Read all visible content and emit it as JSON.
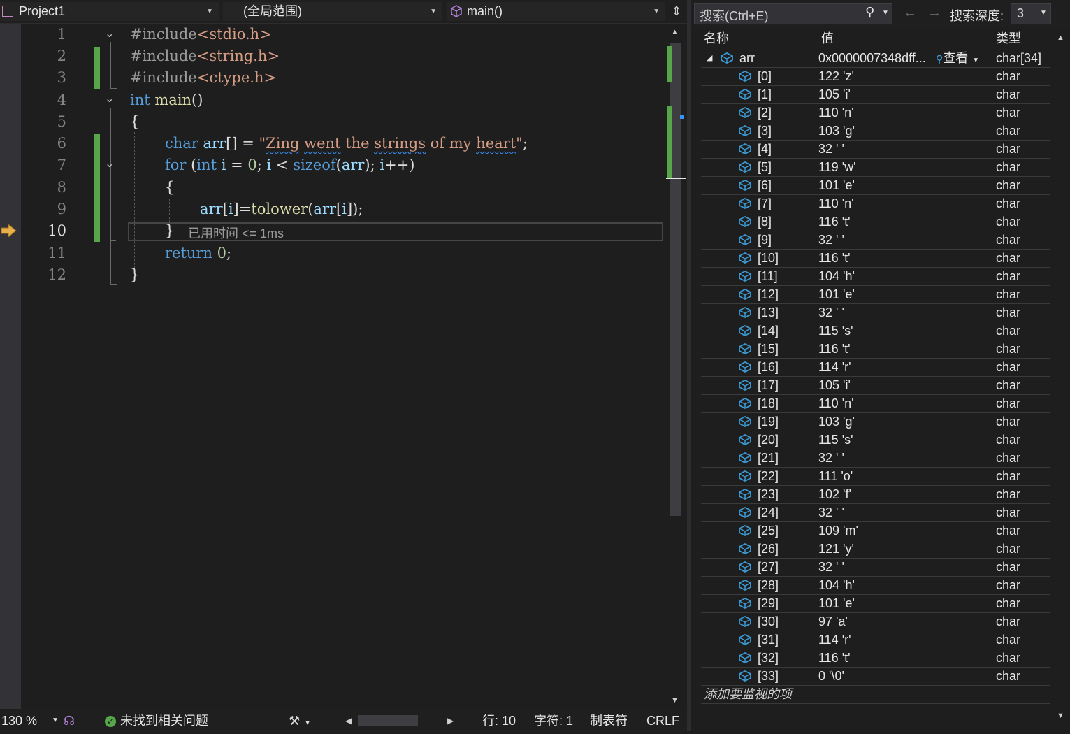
{
  "toolbar": {
    "project": "Project1",
    "scope": "(全局范围)",
    "function": "main()"
  },
  "editor": {
    "lines": [
      {
        "n": "1"
      },
      {
        "n": "2"
      },
      {
        "n": "3"
      },
      {
        "n": "4"
      },
      {
        "n": "5"
      },
      {
        "n": "6"
      },
      {
        "n": "7"
      },
      {
        "n": "8"
      },
      {
        "n": "9"
      },
      {
        "n": "10"
      },
      {
        "n": "11"
      },
      {
        "n": "12"
      }
    ],
    "current_line": "10",
    "code": {
      "l1_kw": "#include",
      "l1_hdr": "<stdio.h>",
      "l2_kw": "#include",
      "l2_hdr": "<string.h>",
      "l3_kw": "#include",
      "l3_hdr": "<ctype.h>",
      "l4_type": "int",
      "l4_fn": " main",
      "l4_paren": "()",
      "l5": "{",
      "l6_type": "char",
      "l6_var": " arr",
      "l6_op": "[] = ",
      "l6_q1": "\"",
      "l6_w1": "Zing",
      "l6_s1": " ",
      "l6_w2": "went",
      "l6_s2": " the ",
      "l6_w3": "strings",
      "l6_s3": " of my ",
      "l6_w4": "heart",
      "l6_q2": "\"",
      "l6_end": ";",
      "l7_kw": "for",
      "l7_a": " (",
      "l7_type": "int",
      "l7_i": " i",
      "l7_b": " = ",
      "l7_zero": "0",
      "l7_c": "; ",
      "l7_i2": "i",
      "l7_d": " < ",
      "l7_sizeof": "sizeof",
      "l7_e": "(",
      "l7_arr": "arr",
      "l7_f": "); ",
      "l7_i3": "i",
      "l7_g": "++)",
      "l8": "{",
      "l9_arr": "arr",
      "l9_a": "[",
      "l9_i": "i",
      "l9_b": "]=",
      "l9_fn": "tolower",
      "l9_c": "(",
      "l9_arr2": "arr",
      "l9_d": "[",
      "l9_i2": "i",
      "l9_e": "]);",
      "l10": "}",
      "l10_hint": "已用时间 <= 1ms",
      "l11_kw": "return",
      "l11_num": " 0",
      "l11_end": ";",
      "l12": "}"
    }
  },
  "status": {
    "zoom": "130 %",
    "issues": "未找到相关问题",
    "line": "行: 10",
    "col": "字符: 1",
    "indent": "制表符",
    "eol": "CRLF"
  },
  "watch": {
    "search_placeholder": "搜索(Ctrl+E)",
    "depth_label": "搜索深度:",
    "depth_value": "3",
    "headers": {
      "name": "名称",
      "value": "值",
      "type": "类型"
    },
    "root": {
      "name": "arr",
      "value": "0x0000007348dff...",
      "view": "查看",
      "type": "char[34]"
    },
    "items": [
      {
        "name": "[0]",
        "value": "122 'z'",
        "type": "char"
      },
      {
        "name": "[1]",
        "value": "105 'i'",
        "type": "char"
      },
      {
        "name": "[2]",
        "value": "110 'n'",
        "type": "char"
      },
      {
        "name": "[3]",
        "value": "103 'g'",
        "type": "char"
      },
      {
        "name": "[4]",
        "value": "32 ' '",
        "type": "char"
      },
      {
        "name": "[5]",
        "value": "119 'w'",
        "type": "char"
      },
      {
        "name": "[6]",
        "value": "101 'e'",
        "type": "char"
      },
      {
        "name": "[7]",
        "value": "110 'n'",
        "type": "char"
      },
      {
        "name": "[8]",
        "value": "116 't'",
        "type": "char"
      },
      {
        "name": "[9]",
        "value": "32 ' '",
        "type": "char"
      },
      {
        "name": "[10]",
        "value": "116 't'",
        "type": "char"
      },
      {
        "name": "[11]",
        "value": "104 'h'",
        "type": "char"
      },
      {
        "name": "[12]",
        "value": "101 'e'",
        "type": "char"
      },
      {
        "name": "[13]",
        "value": "32 ' '",
        "type": "char"
      },
      {
        "name": "[14]",
        "value": "115 's'",
        "type": "char"
      },
      {
        "name": "[15]",
        "value": "116 't'",
        "type": "char"
      },
      {
        "name": "[16]",
        "value": "114 'r'",
        "type": "char"
      },
      {
        "name": "[17]",
        "value": "105 'i'",
        "type": "char"
      },
      {
        "name": "[18]",
        "value": "110 'n'",
        "type": "char"
      },
      {
        "name": "[19]",
        "value": "103 'g'",
        "type": "char"
      },
      {
        "name": "[20]",
        "value": "115 's'",
        "type": "char"
      },
      {
        "name": "[21]",
        "value": "32 ' '",
        "type": "char"
      },
      {
        "name": "[22]",
        "value": "111 'o'",
        "type": "char"
      },
      {
        "name": "[23]",
        "value": "102 'f'",
        "type": "char"
      },
      {
        "name": "[24]",
        "value": "32 ' '",
        "type": "char"
      },
      {
        "name": "[25]",
        "value": "109 'm'",
        "type": "char"
      },
      {
        "name": "[26]",
        "value": "121 'y'",
        "type": "char"
      },
      {
        "name": "[27]",
        "value": "32 ' '",
        "type": "char"
      },
      {
        "name": "[28]",
        "value": "104 'h'",
        "type": "char"
      },
      {
        "name": "[29]",
        "value": "101 'e'",
        "type": "char"
      },
      {
        "name": "[30]",
        "value": "97 'a'",
        "type": "char"
      },
      {
        "name": "[31]",
        "value": "114 'r'",
        "type": "char"
      },
      {
        "name": "[32]",
        "value": "116 't'",
        "type": "char"
      },
      {
        "name": "[33]",
        "value": "0 '\\0'",
        "type": "char"
      }
    ],
    "add_watch": "添加要监视的项"
  },
  "colors": {
    "accent": "#007acc",
    "git_added": "#57a64a",
    "breakpoint_arrow": "#e8b04b"
  }
}
